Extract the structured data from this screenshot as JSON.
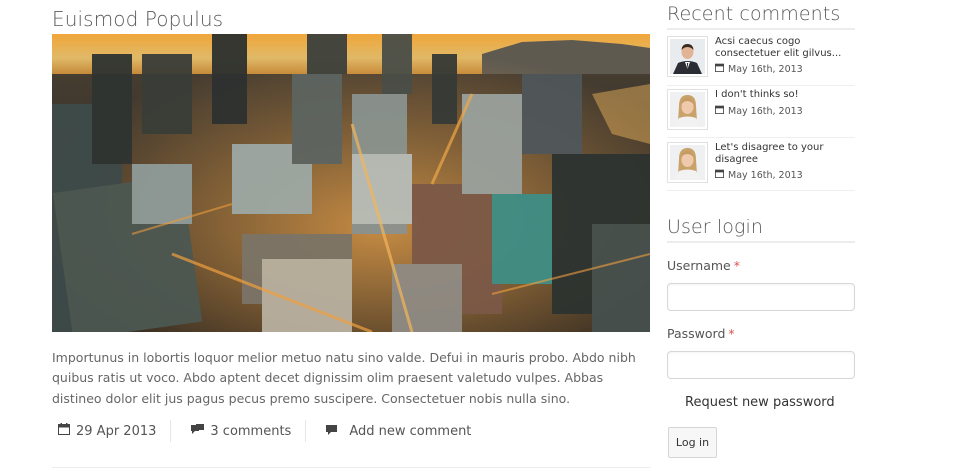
{
  "article": {
    "title": "Euismod Populus",
    "body": "Importunus in lobortis loquor melior metuo natu sino valde. Defui in mauris probo. Abdo nibh quibus ratis ut voco. Abdo aptent decet dignissim olim praesent valetudo vulpes. Abbas distineo dolor elit jus pagus pecus premo suscipere. Consectetuer nobis nulla sino.",
    "date": "29 Apr 2013",
    "comments_count": "3 comments",
    "add_comment": "Add new comment",
    "icons": {
      "date": "calendar-icon",
      "comments": "comments-icon",
      "add": "comment-icon"
    }
  },
  "sidebar": {
    "recent_comments": {
      "title": "Recent comments",
      "items": [
        {
          "text": "Acsi caecus cogo consectetuer elit gilvus...",
          "date": "May 16th, 2013",
          "avatar": "man-avatar"
        },
        {
          "text": "I don't thinks so!",
          "date": "May 16th, 2013",
          "avatar": "woman-avatar"
        },
        {
          "text": "Let's disagree to your disagree",
          "date": "May 16th, 2013",
          "avatar": "woman-avatar"
        }
      ]
    },
    "login": {
      "title": "User login",
      "username_label": "Username",
      "password_label": "Password",
      "required_marker": "*",
      "request_password": "Request new password",
      "login_button": "Log in"
    }
  },
  "colors": {
    "required": "#d9534f",
    "heading": "#5a5a5a",
    "text": "#666666"
  }
}
